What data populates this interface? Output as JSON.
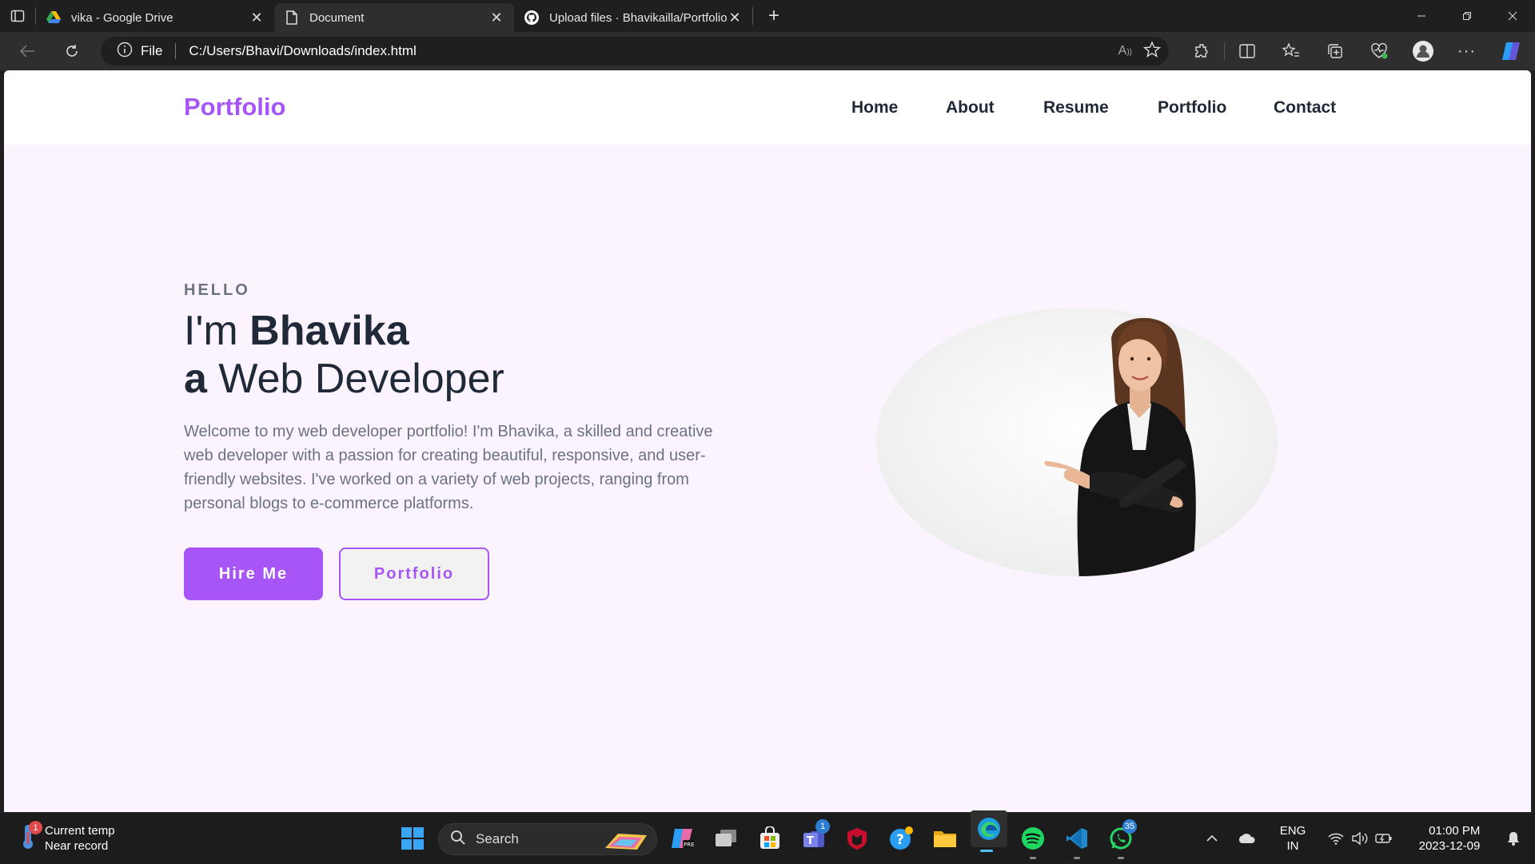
{
  "browser": {
    "tabs": [
      {
        "title": "vika - Google Drive",
        "icon": "google-drive-icon",
        "active": false
      },
      {
        "title": "Document",
        "icon": "document-icon",
        "active": true
      },
      {
        "title": "Upload files · Bhavikailla/Portfolio",
        "icon": "github-icon",
        "active": false
      }
    ],
    "address": {
      "scheme_label": "File",
      "url": "C:/Users/Bhavi/Downloads/index.html"
    }
  },
  "site": {
    "brand": "Portfolio",
    "nav": [
      "Home",
      "About",
      "Resume",
      "Portfolio",
      "Contact"
    ],
    "hero": {
      "greeting": "HELLO",
      "line1_prefix": "I'm ",
      "name": "Bhavika",
      "line2_prefix": "a",
      "role": " Web Developer",
      "description": "Welcome to my web developer portfolio! I'm Bhavika, a skilled and creative web developer with a passion for creating beautiful, responsive, and user-friendly websites. I've worked on a variety of web projects, ranging from personal blogs to e-commerce platforms.",
      "primary_button": "Hire Me",
      "secondary_button": "Portfolio"
    },
    "accent_color": "#a855f7"
  },
  "taskbar": {
    "weather": {
      "line1": "Current temp",
      "line2": "Near record",
      "badge": "1"
    },
    "search_label": "Search",
    "badges": {
      "teams": "1",
      "whatsapp": "35"
    },
    "language": {
      "line1": "ENG",
      "line2": "IN"
    },
    "clock": {
      "time": "01:00 PM",
      "date": "2023-12-09"
    }
  }
}
